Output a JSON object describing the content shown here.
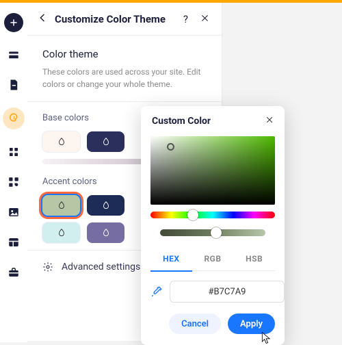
{
  "header": {
    "title": "Customize Color Theme"
  },
  "theme_section": {
    "title": "Color theme",
    "description": "These colors are used across your site. Edit colors or change your whole theme."
  },
  "base": {
    "label": "Base colors"
  },
  "accent": {
    "label": "Accent colors"
  },
  "advanced": {
    "label": "Advanced settings"
  },
  "popup": {
    "title": "Custom Color",
    "tabs": {
      "hex": "HEX",
      "rgb": "RGB",
      "hsb": "HSB"
    },
    "hex_value": "#B7C7A9",
    "cancel": "Cancel",
    "apply": "Apply"
  },
  "sidebar_icons": [
    "add",
    "card",
    "page",
    "design",
    "sections",
    "app",
    "media",
    "table",
    "briefcase"
  ]
}
